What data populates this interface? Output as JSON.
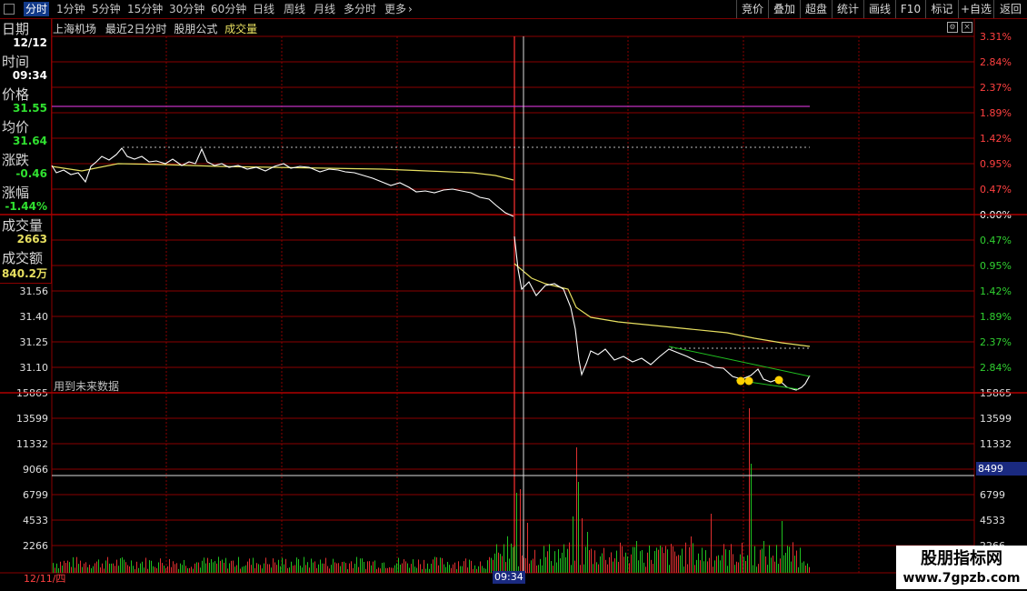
{
  "toolbar": {
    "tabs": [
      "分时",
      "1分钟",
      "5分钟",
      "15分钟",
      "30分钟",
      "60分钟",
      "日线",
      "周线",
      "月线",
      "多分时",
      "更多"
    ],
    "right_buttons": [
      "竞价",
      "叠加",
      "超盘",
      "统计",
      "画线",
      "F10",
      "标记",
      "+自选",
      "返回"
    ]
  },
  "header": {
    "stock": "上海机场",
    "period": "最近2日分时",
    "formula": "股朋公式",
    "indicator": "成交量"
  },
  "info_panel": {
    "date_label": "日期",
    "date": "12/12",
    "time_label": "时间",
    "time": "09:34",
    "price_label": "价格",
    "price": "31.55",
    "avg_label": "均价",
    "avg": "31.64",
    "change_label": "涨跌",
    "change": "-0.46",
    "pct_label": "涨幅",
    "pct": "-1.44%",
    "vol_label": "成交量",
    "vol": "2663",
    "amt_label": "成交额",
    "amt": "840.2万"
  },
  "price_axis": {
    "left": [
      "31.56",
      "31.40",
      "31.25",
      "31.10"
    ],
    "right": [
      "3.31%",
      "2.84%",
      "2.37%",
      "1.89%",
      "1.42%",
      "0.95%",
      "0.47%",
      "0.00%",
      "0.47%",
      "0.95%",
      "1.42%",
      "1.89%",
      "2.37%",
      "2.84%"
    ],
    "colors": {
      "up": "#ff4040",
      "zero": "#ffffff",
      "down": "#30d030"
    }
  },
  "volume_axis": {
    "left": [
      "15865",
      "13599",
      "11332",
      "9066",
      "6799",
      "4533",
      "2266"
    ],
    "right": [
      "15865",
      "13599",
      "11332",
      "6799",
      "4533",
      "2266"
    ],
    "cursor_value": "8499"
  },
  "note": "用到未来数据",
  "bottom": {
    "date": "12/11/四",
    "time": "09:34"
  },
  "watermark": {
    "line1": "股朋指标网",
    "line2": "www.7gpzb.com"
  },
  "colors": {
    "grid": "#8a0000",
    "price_line": "#ffffff",
    "avg_line": "#e8e060",
    "magenta": "#c030c0",
    "trend": "#20c020",
    "marker": "#ffd000"
  },
  "chart_data": {
    "type": "line",
    "title": "上海机场 最近2日分时",
    "series": [
      {
        "name": "价格",
        "values": [
          31.91,
          31.95,
          31.98,
          31.96,
          31.94,
          31.93,
          31.92,
          31.9,
          31.88,
          31.8,
          31.72,
          31.6,
          31.52,
          31.42,
          31.3,
          31.22,
          31.08,
          31.12,
          31.1,
          31.09,
          31.1,
          31.06,
          31.04,
          31.02,
          31.07
        ]
      },
      {
        "name": "均价",
        "values": [
          31.95,
          31.94,
          31.93,
          31.92,
          31.91,
          31.9,
          31.89,
          31.88,
          31.86,
          31.84,
          31.83,
          31.55,
          31.53,
          31.5,
          31.38,
          31.34,
          31.32,
          31.3,
          31.29,
          31.28,
          31.27,
          31.26,
          31.24,
          31.23,
          31.22
        ]
      }
    ],
    "ylim": [
      31.0,
      32.2
    ]
  }
}
